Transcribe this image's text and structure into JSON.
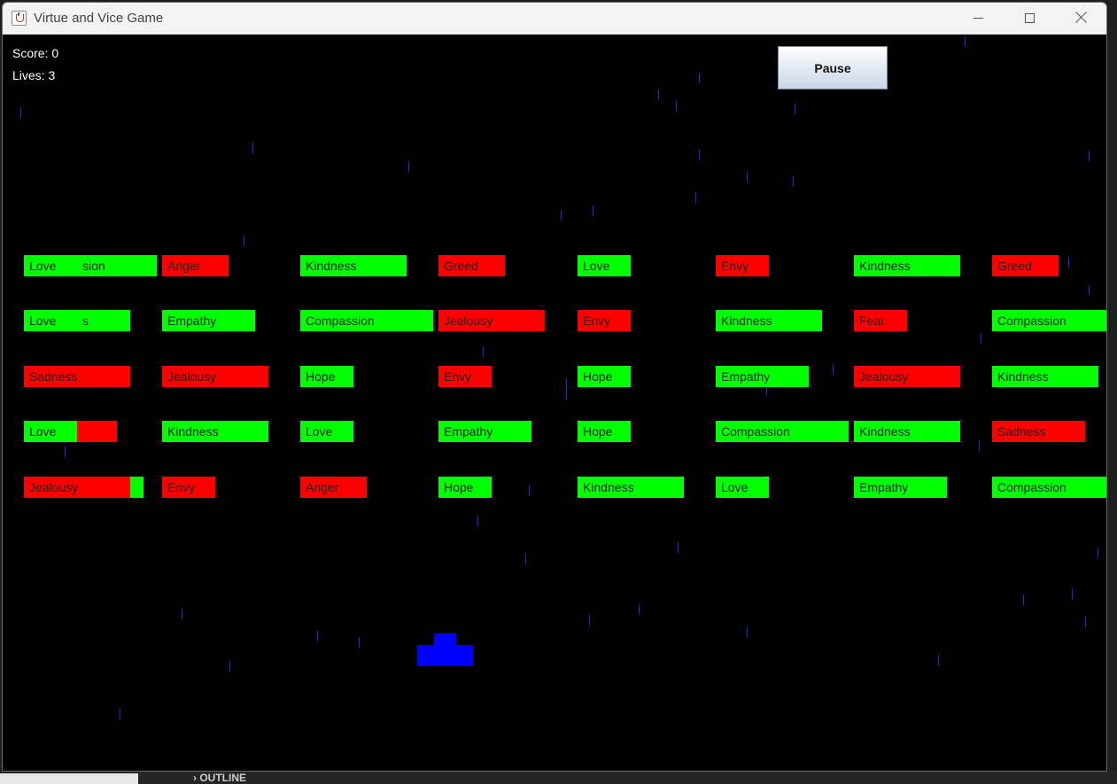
{
  "window": {
    "title": "Virtue and Vice Game"
  },
  "background": {
    "panel_label": "OUTLINE"
  },
  "hud": {
    "score_label": "Score: 0",
    "lives_label": "Lives: 3",
    "pause_label": "Pause"
  },
  "colors": {
    "virtue": "#00ff00",
    "vice": "#ff0000",
    "paddle": "#0000ff",
    "rain": "#1b2bd6"
  },
  "bricks": [
    {
      "label": "Love",
      "kind": "virtue"
    },
    {
      "label": "Anger",
      "kind": "vice"
    },
    {
      "label": "Kindness",
      "kind": "virtue"
    },
    {
      "label": "Greed",
      "kind": "vice"
    },
    {
      "label": "Love",
      "kind": "virtue"
    },
    {
      "label": "Envy",
      "kind": "vice"
    },
    {
      "label": "Kindness",
      "kind": "virtue"
    },
    {
      "label": "Greed",
      "kind": "vice"
    },
    {
      "label": "Love",
      "kind": "virtue"
    },
    {
      "label": "Empathy",
      "kind": "virtue"
    },
    {
      "label": "Compassion",
      "kind": "virtue"
    },
    {
      "label": "Jealousy",
      "kind": "vice"
    },
    {
      "label": "Envy",
      "kind": "vice"
    },
    {
      "label": "Kindness",
      "kind": "virtue"
    },
    {
      "label": "Fear",
      "kind": "vice"
    },
    {
      "label": "Compassion",
      "kind": "virtue"
    },
    {
      "label": "Sadness",
      "kind": "vice"
    },
    {
      "label": "Jealousy",
      "kind": "vice"
    },
    {
      "label": "Hope",
      "kind": "virtue"
    },
    {
      "label": "Envy",
      "kind": "vice"
    },
    {
      "label": "Hope",
      "kind": "virtue"
    },
    {
      "label": "Empathy",
      "kind": "virtue"
    },
    {
      "label": "Jealousy",
      "kind": "vice"
    },
    {
      "label": "Kindness",
      "kind": "virtue"
    },
    {
      "label": "Love",
      "kind": "virtue"
    },
    {
      "label": "Kindness",
      "kind": "virtue"
    },
    {
      "label": "Love",
      "kind": "virtue"
    },
    {
      "label": "Empathy",
      "kind": "virtue"
    },
    {
      "label": "Hope",
      "kind": "virtue"
    },
    {
      "label": "Compassion",
      "kind": "virtue"
    },
    {
      "label": "Kindness",
      "kind": "virtue"
    },
    {
      "label": "Sadness",
      "kind": "vice"
    },
    {
      "label": "Jealousy",
      "kind": "vice"
    },
    {
      "label": "Envy",
      "kind": "vice"
    },
    {
      "label": "Anger",
      "kind": "vice"
    },
    {
      "label": "Hope",
      "kind": "virtue"
    },
    {
      "label": "Kindness",
      "kind": "virtue"
    },
    {
      "label": "Love",
      "kind": "virtue"
    },
    {
      "label": "Empathy",
      "kind": "virtue"
    },
    {
      "label": "Compassion",
      "kind": "virtue"
    }
  ],
  "overlay_fragments": [
    "sion",
    "s"
  ]
}
